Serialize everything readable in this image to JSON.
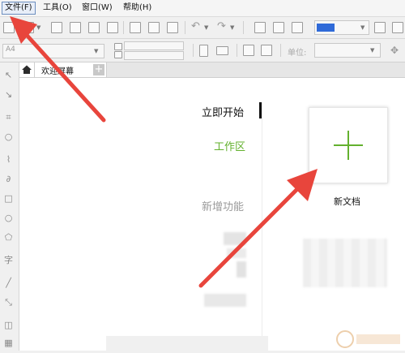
{
  "menubar": {
    "items": [
      "文件(F)",
      "工具(O)",
      "窗口(W)",
      "帮助(H)"
    ]
  },
  "toolbar2": {
    "page_size_value": "A4",
    "unit_label": "单位:"
  },
  "tabs": {
    "welcome_label": "欢迎屏幕"
  },
  "welcome": {
    "nav_start": "立即开始",
    "nav_workspace": "工作区",
    "nav_new_features": "新增功能",
    "new_doc_label": "新文档"
  },
  "colors": {
    "accent_green": "#63b12e",
    "arrow_red": "#e8453c",
    "menu_active_border": "#6c8ebf",
    "toolbar_blue": "#2f6ad8"
  }
}
